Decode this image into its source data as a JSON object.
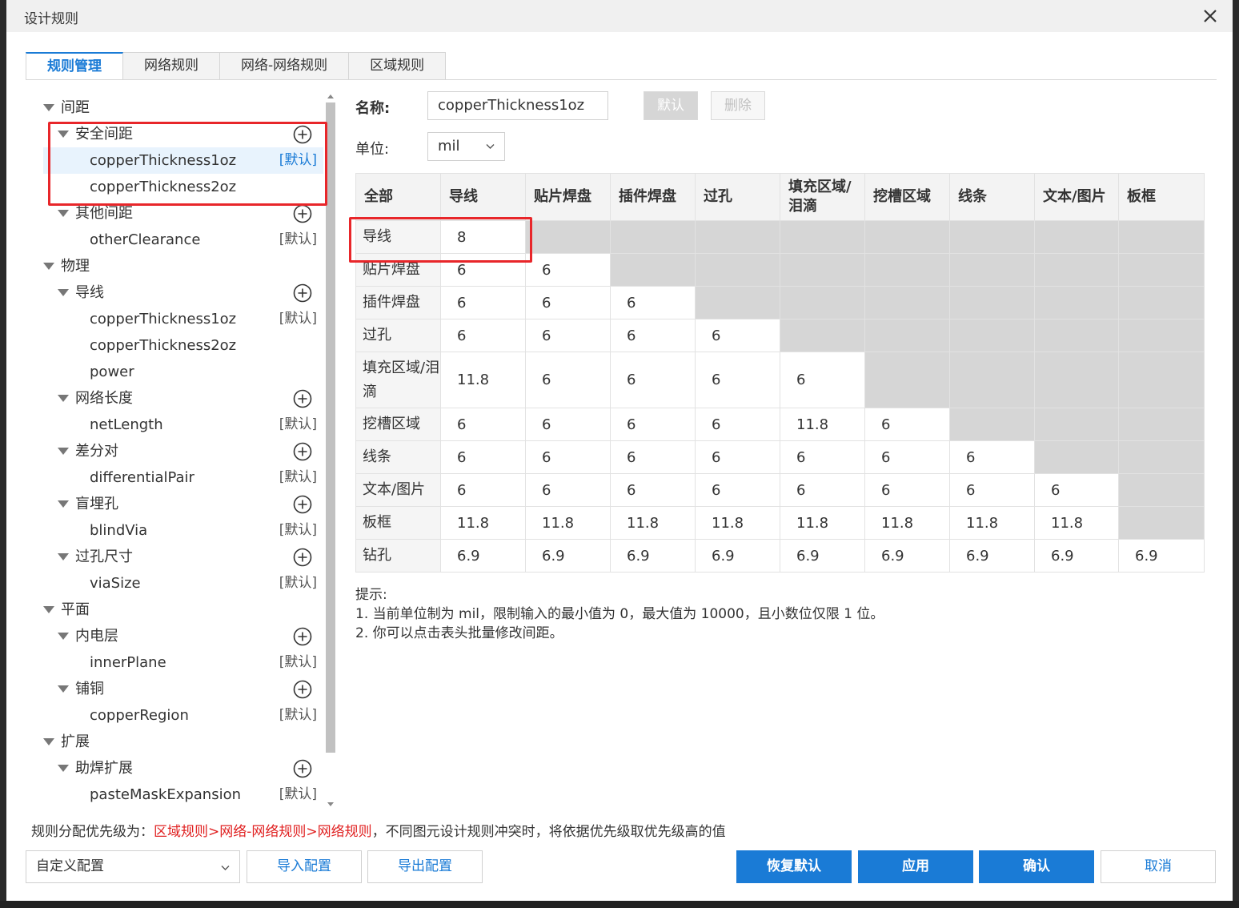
{
  "dialog": {
    "title": "设计规则"
  },
  "tabs": [
    {
      "label": "规则管理",
      "active": true
    },
    {
      "label": "网络规则",
      "active": false
    },
    {
      "label": "网络-网络规则",
      "active": false
    },
    {
      "label": "区域规则",
      "active": false
    }
  ],
  "tree": {
    "items": [
      {
        "label": "间距",
        "level": 0
      },
      {
        "label": "安全间距",
        "level": 1,
        "addable": true
      },
      {
        "label": "copperThickness1oz",
        "level": 2,
        "default": "[默认]",
        "selected": true
      },
      {
        "label": "copperThickness2oz",
        "level": 2
      },
      {
        "label": "其他间距",
        "level": 1,
        "addable": true
      },
      {
        "label": "otherClearance",
        "level": 2,
        "default": "[默认]"
      },
      {
        "label": "物理",
        "level": 0
      },
      {
        "label": "导线",
        "level": 1,
        "addable": true
      },
      {
        "label": "copperThickness1oz",
        "level": 2,
        "default": "[默认]"
      },
      {
        "label": "copperThickness2oz",
        "level": 2
      },
      {
        "label": "power",
        "level": 2
      },
      {
        "label": "网络长度",
        "level": 1,
        "addable": true
      },
      {
        "label": "netLength",
        "level": 2,
        "default": "[默认]"
      },
      {
        "label": "差分对",
        "level": 1,
        "addable": true
      },
      {
        "label": "differentialPair",
        "level": 2,
        "default": "[默认]"
      },
      {
        "label": "盲埋孔",
        "level": 1,
        "addable": true
      },
      {
        "label": "blindVia",
        "level": 2,
        "default": "[默认]"
      },
      {
        "label": "过孔尺寸",
        "level": 1,
        "addable": true
      },
      {
        "label": "viaSize",
        "level": 2,
        "default": "[默认]"
      },
      {
        "label": "平面",
        "level": 0
      },
      {
        "label": "内电层",
        "level": 1,
        "addable": true
      },
      {
        "label": "innerPlane",
        "level": 2,
        "default": "[默认]"
      },
      {
        "label": "铺铜",
        "level": 1,
        "addable": true
      },
      {
        "label": "copperRegion",
        "level": 2,
        "default": "[默认]"
      },
      {
        "label": "扩展",
        "level": 0
      },
      {
        "label": "助焊扩展",
        "level": 1,
        "addable": true
      },
      {
        "label": "pasteMaskExpansion",
        "level": 2,
        "default": "[默认]"
      }
    ]
  },
  "form": {
    "name_label": "名称:",
    "name_value": "copperThickness1oz",
    "default_button": "默认",
    "delete_button": "删除",
    "unit_label": "单位:",
    "unit_value": "mil"
  },
  "matrix": {
    "headers": [
      "全部",
      "导线",
      "贴片焊盘",
      "插件焊盘",
      "过孔",
      "填充区域/泪滴",
      "挖槽区域",
      "线条",
      "文本/图片",
      "板框"
    ],
    "rows": [
      {
        "label": "导线",
        "cells": [
          "8",
          null,
          null,
          null,
          null,
          null,
          null,
          null,
          null
        ]
      },
      {
        "label": "贴片焊盘",
        "cells": [
          "6",
          "6",
          null,
          null,
          null,
          null,
          null,
          null,
          null
        ]
      },
      {
        "label": "插件焊盘",
        "cells": [
          "6",
          "6",
          "6",
          null,
          null,
          null,
          null,
          null,
          null
        ]
      },
      {
        "label": "过孔",
        "cells": [
          "6",
          "6",
          "6",
          "6",
          null,
          null,
          null,
          null,
          null
        ]
      },
      {
        "label": "填充区域/泪滴",
        "cells": [
          "11.8",
          "6",
          "6",
          "6",
          "6",
          null,
          null,
          null,
          null
        ],
        "tall": true
      },
      {
        "label": "挖槽区域",
        "cells": [
          "6",
          "6",
          "6",
          "6",
          "11.8",
          "6",
          null,
          null,
          null
        ]
      },
      {
        "label": "线条",
        "cells": [
          "6",
          "6",
          "6",
          "6",
          "6",
          "6",
          "6",
          null,
          null
        ]
      },
      {
        "label": "文本/图片",
        "cells": [
          "6",
          "6",
          "6",
          "6",
          "6",
          "6",
          "6",
          "6",
          null
        ]
      },
      {
        "label": "板框",
        "cells": [
          "11.8",
          "11.8",
          "11.8",
          "11.8",
          "11.8",
          "11.8",
          "11.8",
          "11.8",
          null
        ]
      },
      {
        "label": "钻孔",
        "cells": [
          "6.9",
          "6.9",
          "6.9",
          "6.9",
          "6.9",
          "6.9",
          "6.9",
          "6.9",
          "6.9"
        ]
      }
    ]
  },
  "tips": {
    "title": "提示:",
    "line1": "1. 当前单位制为 mil，限制输入的最小值为 0，最大值为 10000，且小数位仅限 1 位。",
    "line2": "2. 你可以点击表头批量修改间距。"
  },
  "footer": {
    "priority_prefix": "规则分配优先级为：",
    "priority_order": "区域规则>网络-网络规则>网络规则",
    "priority_suffix": "，不同图元设计规则冲突时，将依据优先级取优先级高的值",
    "config_value": "自定义配置",
    "import_button": "导入配置",
    "export_button": "导出配置",
    "restore_button": "恢复默认",
    "apply_button": "应用",
    "confirm_button": "确认",
    "cancel_button": "取消"
  },
  "colors": {
    "accent": "#1a7bd6",
    "highlight": "#e8262a",
    "disabled_cell": "#d6d6d6"
  }
}
